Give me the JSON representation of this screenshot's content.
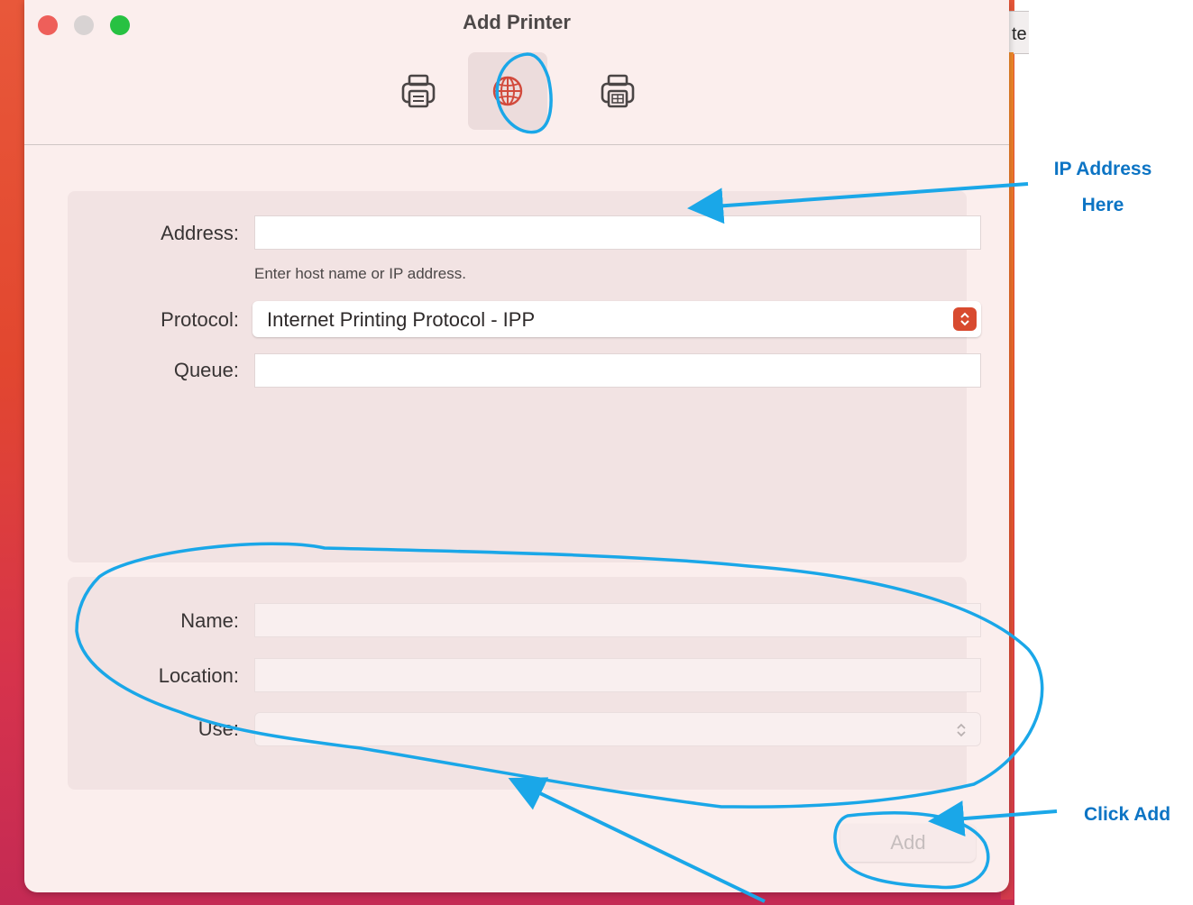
{
  "window": {
    "title": "Add Printer"
  },
  "background": {
    "partial_text": "te"
  },
  "toolbar": {
    "items": [
      {
        "name": "default-printer-tab",
        "icon": "printer-icon",
        "selected": false
      },
      {
        "name": "ip-printer-tab",
        "icon": "globe-icon",
        "selected": true
      },
      {
        "name": "windows-printer-tab",
        "icon": "fax-printer-icon",
        "selected": false
      }
    ]
  },
  "form": {
    "address_label": "Address:",
    "address_value": "",
    "address_hint": "Enter host name or IP address.",
    "protocol_label": "Protocol:",
    "protocol_value": "Internet Printing Protocol - IPP",
    "queue_label": "Queue:",
    "queue_value": ""
  },
  "details": {
    "name_label": "Name:",
    "name_value": "",
    "location_label": "Location:",
    "location_value": "",
    "use_label": "Use:",
    "use_value": ""
  },
  "actions": {
    "add_label": "Add"
  },
  "annotations": {
    "ip_address_line1": "IP Address",
    "ip_address_line2": "Here",
    "click_add": "Click Add",
    "color": "#1aa7e8"
  }
}
